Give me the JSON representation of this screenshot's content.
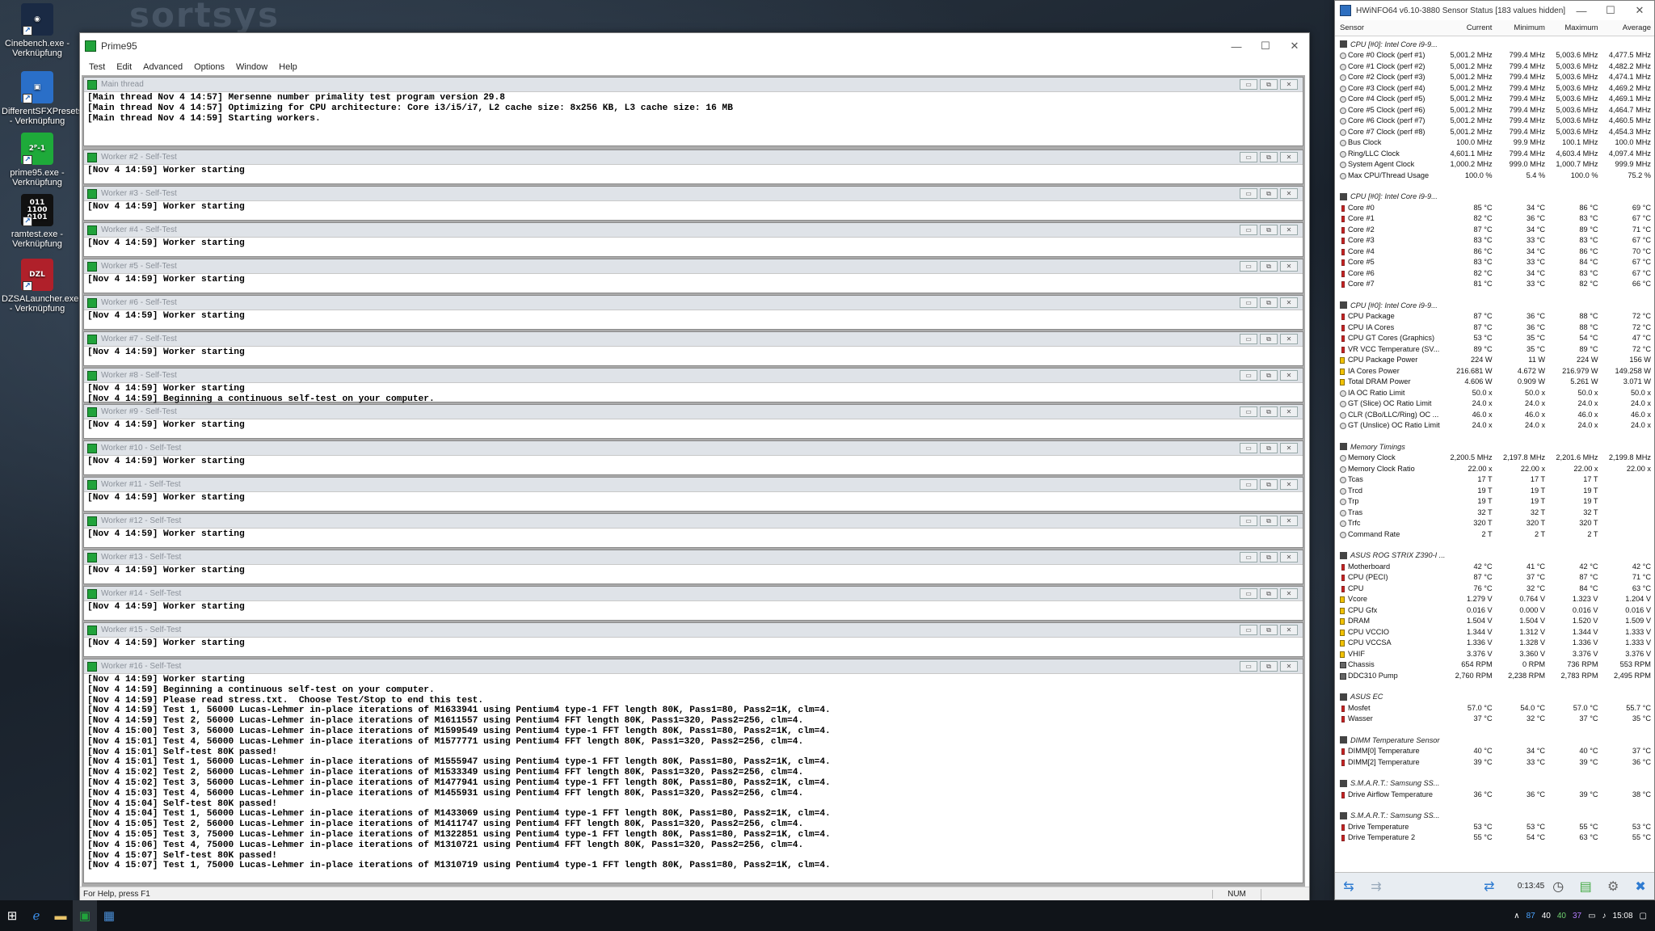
{
  "desktop": {
    "background_text": "sortsys",
    "icons": [
      {
        "label": "Cinebench.exe - Verknüpfung",
        "glyph": "◉",
        "color": "#1a2a44"
      },
      {
        "label": "DifferentSFXPresets... - Verknüpfung",
        "glyph": "▣",
        "color": "#2a6fc8"
      },
      {
        "label": "prime95.exe - Verknüpfung",
        "glyph": "2ᴾ-1",
        "color": "#1eaa3a"
      },
      {
        "label": "ramtest.exe - Verknüpfung",
        "glyph": "011\n1100\n0101",
        "color": "#111111"
      },
      {
        "label": "DZSALauncher.exe - Verknüpfung",
        "glyph": "DZL",
        "color": "#b0202a"
      }
    ]
  },
  "prime95": {
    "title": "Prime95",
    "menu": [
      "Test",
      "Edit",
      "Advanced",
      "Options",
      "Window",
      "Help"
    ],
    "status_text": "For Help, press F1",
    "status_num": "NUM",
    "main_thread": {
      "title": "Main thread",
      "lines": [
        "[Main thread Nov 4 14:57] Mersenne number primality test program version 29.8",
        "[Main thread Nov 4 14:57] Optimizing for CPU architecture: Core i3/i5/i7, L2 cache size: 8x256 KB, L3 cache size: 16 MB",
        "[Main thread Nov 4 14:59] Starting workers."
      ]
    },
    "workers": [
      {
        "title": "Worker #2 - Self-Test",
        "lines": [
          "[Nov 4 14:59] Worker starting"
        ]
      },
      {
        "title": "Worker #3 - Self-Test",
        "lines": [
          "[Nov 4 14:59] Worker starting"
        ]
      },
      {
        "title": "Worker #4 - Self-Test",
        "lines": [
          "[Nov 4 14:59] Worker starting"
        ]
      },
      {
        "title": "Worker #5 - Self-Test",
        "lines": [
          "[Nov 4 14:59] Worker starting"
        ]
      },
      {
        "title": "Worker #6 - Self-Test",
        "lines": [
          "[Nov 4 14:59] Worker starting"
        ]
      },
      {
        "title": "Worker #7 - Self-Test",
        "lines": [
          "[Nov 4 14:59] Worker starting"
        ]
      },
      {
        "title": "Worker #8 - Self-Test",
        "lines": [
          "[Nov 4 14:59] Worker starting",
          "[Nov 4 14:59] Beginning a continuous self-test on your computer."
        ]
      },
      {
        "title": "Worker #9 - Self-Test",
        "lines": [
          "[Nov 4 14:59] Worker starting"
        ]
      },
      {
        "title": "Worker #10 - Self-Test",
        "lines": [
          "[Nov 4 14:59] Worker starting"
        ]
      },
      {
        "title": "Worker #11 - Self-Test",
        "lines": [
          "[Nov 4 14:59] Worker starting"
        ]
      },
      {
        "title": "Worker #12 - Self-Test",
        "lines": [
          "[Nov 4 14:59] Worker starting"
        ]
      },
      {
        "title": "Worker #13 - Self-Test",
        "lines": [
          "[Nov 4 14:59] Worker starting"
        ]
      },
      {
        "title": "Worker #14 - Self-Test",
        "lines": [
          "[Nov 4 14:59] Worker starting"
        ]
      },
      {
        "title": "Worker #15 - Self-Test",
        "lines": [
          "[Nov 4 14:59] Worker starting"
        ]
      }
    ],
    "worker16": {
      "title": "Worker #16 - Self-Test",
      "lines": [
        "[Nov 4 14:59] Worker starting",
        "[Nov 4 14:59] Beginning a continuous self-test on your computer.",
        "[Nov 4 14:59] Please read stress.txt.  Choose Test/Stop to end this test.",
        "[Nov 4 14:59] Test 1, 56000 Lucas-Lehmer in-place iterations of M1633941 using Pentium4 type-1 FFT length 80K, Pass1=80, Pass2=1K, clm=4.",
        "[Nov 4 14:59] Test 2, 56000 Lucas-Lehmer in-place iterations of M1611557 using Pentium4 FFT length 80K, Pass1=320, Pass2=256, clm=4.",
        "[Nov 4 15:00] Test 3, 56000 Lucas-Lehmer in-place iterations of M1599549 using Pentium4 type-1 FFT length 80K, Pass1=80, Pass2=1K, clm=4.",
        "[Nov 4 15:01] Test 4, 56000 Lucas-Lehmer in-place iterations of M1577771 using Pentium4 FFT length 80K, Pass1=320, Pass2=256, clm=4.",
        "[Nov 4 15:01] Self-test 80K passed!",
        "[Nov 4 15:01] Test 1, 56000 Lucas-Lehmer in-place iterations of M1555947 using Pentium4 type-1 FFT length 80K, Pass1=80, Pass2=1K, clm=4.",
        "[Nov 4 15:02] Test 2, 56000 Lucas-Lehmer in-place iterations of M1533349 using Pentium4 FFT length 80K, Pass1=320, Pass2=256, clm=4.",
        "[Nov 4 15:02] Test 3, 56000 Lucas-Lehmer in-place iterations of M1477941 using Pentium4 type-1 FFT length 80K, Pass1=80, Pass2=1K, clm=4.",
        "[Nov 4 15:03] Test 4, 56000 Lucas-Lehmer in-place iterations of M1455931 using Pentium4 FFT length 80K, Pass1=320, Pass2=256, clm=4.",
        "[Nov 4 15:04] Self-test 80K passed!",
        "[Nov 4 15:04] Test 1, 56000 Lucas-Lehmer in-place iterations of M1433069 using Pentium4 type-1 FFT length 80K, Pass1=80, Pass2=1K, clm=4.",
        "[Nov 4 15:05] Test 2, 56000 Lucas-Lehmer in-place iterations of M1411747 using Pentium4 FFT length 80K, Pass1=320, Pass2=256, clm=4.",
        "[Nov 4 15:05] Test 3, 75000 Lucas-Lehmer in-place iterations of M1322851 using Pentium4 type-1 FFT length 80K, Pass1=80, Pass2=1K, clm=4.",
        "[Nov 4 15:06] Test 4, 75000 Lucas-Lehmer in-place iterations of M1310721 using Pentium4 FFT length 80K, Pass1=320, Pass2=256, clm=4.",
        "[Nov 4 15:07] Self-test 80K passed!",
        "[Nov 4 15:07] Test 1, 75000 Lucas-Lehmer in-place iterations of M1310719 using Pentium4 type-1 FFT length 80K, Pass1=80, Pass2=1K, clm=4."
      ]
    }
  },
  "hwinfo": {
    "title": "HWiNFO64 v6.10-3880 Sensor Status [183 values hidden]",
    "columns": [
      "Sensor",
      "Current",
      "Minimum",
      "Maximum",
      "Average"
    ],
    "elapsed": "0:13:45",
    "groups": [
      {
        "name": "CPU [#0]: Intel Core i9-9...",
        "rows": [
          [
            "Core #0 Clock (perf #1)",
            "5,001.2 MHz",
            "799.4 MHz",
            "5,003.6 MHz",
            "4,477.5 MHz",
            "c"
          ],
          [
            "Core #1 Clock (perf #2)",
            "5,001.2 MHz",
            "799.4 MHz",
            "5,003.6 MHz",
            "4,482.2 MHz",
            "c"
          ],
          [
            "Core #2 Clock (perf #3)",
            "5,001.2 MHz",
            "799.4 MHz",
            "5,003.6 MHz",
            "4,474.1 MHz",
            "c"
          ],
          [
            "Core #3 Clock (perf #4)",
            "5,001.2 MHz",
            "799.4 MHz",
            "5,003.6 MHz",
            "4,469.2 MHz",
            "c"
          ],
          [
            "Core #4 Clock (perf #5)",
            "5,001.2 MHz",
            "799.4 MHz",
            "5,003.6 MHz",
            "4,469.1 MHz",
            "c"
          ],
          [
            "Core #5 Clock (perf #6)",
            "5,001.2 MHz",
            "799.4 MHz",
            "5,003.6 MHz",
            "4,464.7 MHz",
            "c"
          ],
          [
            "Core #6 Clock (perf #7)",
            "5,001.2 MHz",
            "799.4 MHz",
            "5,003.6 MHz",
            "4,460.5 MHz",
            "c"
          ],
          [
            "Core #7 Clock (perf #8)",
            "5,001.2 MHz",
            "799.4 MHz",
            "5,003.6 MHz",
            "4,454.3 MHz",
            "c"
          ],
          [
            "Bus Clock",
            "100.0 MHz",
            "99.9 MHz",
            "100.1 MHz",
            "100.0 MHz",
            "c"
          ],
          [
            "Ring/LLC Clock",
            "4,601.1 MHz",
            "799.4 MHz",
            "4,603.4 MHz",
            "4,097.4 MHz",
            "c"
          ],
          [
            "System Agent Clock",
            "1,000.2 MHz",
            "999.0 MHz",
            "1,000.7 MHz",
            "999.9 MHz",
            "c"
          ],
          [
            "Max CPU/Thread Usage",
            "100.0 %",
            "5.4 %",
            "100.0 %",
            "75.2 %",
            "c"
          ]
        ]
      },
      {
        "name": "CPU [#0]: Intel Core i9-9...",
        "rows": [
          [
            "Core #0",
            "85 °C",
            "34 °C",
            "86 °C",
            "69 °C",
            "t"
          ],
          [
            "Core #1",
            "82 °C",
            "36 °C",
            "83 °C",
            "67 °C",
            "t"
          ],
          [
            "Core #2",
            "87 °C",
            "34 °C",
            "89 °C",
            "71 °C",
            "t"
          ],
          [
            "Core #3",
            "83 °C",
            "33 °C",
            "83 °C",
            "67 °C",
            "t"
          ],
          [
            "Core #4",
            "86 °C",
            "34 °C",
            "86 °C",
            "70 °C",
            "t"
          ],
          [
            "Core #5",
            "83 °C",
            "33 °C",
            "84 °C",
            "67 °C",
            "t"
          ],
          [
            "Core #6",
            "82 °C",
            "34 °C",
            "83 °C",
            "67 °C",
            "t"
          ],
          [
            "Core #7",
            "81 °C",
            "33 °C",
            "82 °C",
            "66 °C",
            "t"
          ]
        ]
      },
      {
        "name": "CPU [#0]: Intel Core i9-9...",
        "rows": [
          [
            "CPU Package",
            "87 °C",
            "36 °C",
            "88 °C",
            "72 °C",
            "t"
          ],
          [
            "CPU IA Cores",
            "87 °C",
            "36 °C",
            "88 °C",
            "72 °C",
            "t"
          ],
          [
            "CPU GT Cores (Graphics)",
            "53 °C",
            "35 °C",
            "54 °C",
            "47 °C",
            "t"
          ],
          [
            "VR VCC Temperature (SV...",
            "89 °C",
            "35 °C",
            "89 °C",
            "72 °C",
            "t"
          ],
          [
            "CPU Package Power",
            "224 W",
            "11 W",
            "224 W",
            "156 W",
            "v"
          ],
          [
            "IA Cores Power",
            "216.681 W",
            "4.672 W",
            "216.979 W",
            "149.258 W",
            "v"
          ],
          [
            "Total DRAM Power",
            "4.606 W",
            "0.909 W",
            "5.261 W",
            "3.071 W",
            "v"
          ],
          [
            "IA OC Ratio Limit",
            "50.0 x",
            "50.0 x",
            "50.0 x",
            "50.0 x",
            "c"
          ],
          [
            "GT (Slice) OC Ratio Limit",
            "24.0 x",
            "24.0 x",
            "24.0 x",
            "24.0 x",
            "c"
          ],
          [
            "CLR (CBo/LLC/Ring) OC ...",
            "46.0 x",
            "46.0 x",
            "46.0 x",
            "46.0 x",
            "c"
          ],
          [
            "GT (Unslice) OC Ratio Limit",
            "24.0 x",
            "24.0 x",
            "24.0 x",
            "24.0 x",
            "c"
          ]
        ]
      },
      {
        "name": "Memory Timings",
        "rows": [
          [
            "Memory Clock",
            "2,200.5 MHz",
            "2,197.8 MHz",
            "2,201.6 MHz",
            "2,199.8 MHz",
            "c"
          ],
          [
            "Memory Clock Ratio",
            "22.00 x",
            "22.00 x",
            "22.00 x",
            "22.00 x",
            "c"
          ],
          [
            "Tcas",
            "17 T",
            "17 T",
            "17 T",
            "",
            "c"
          ],
          [
            "Trcd",
            "19 T",
            "19 T",
            "19 T",
            "",
            "c"
          ],
          [
            "Trp",
            "19 T",
            "19 T",
            "19 T",
            "",
            "c"
          ],
          [
            "Tras",
            "32 T",
            "32 T",
            "32 T",
            "",
            "c"
          ],
          [
            "Trfc",
            "320 T",
            "320 T",
            "320 T",
            "",
            "c"
          ],
          [
            "Command Rate",
            "2 T",
            "2 T",
            "2 T",
            "",
            "c"
          ]
        ]
      },
      {
        "name": "ASUS ROG STRIX Z390-I ...",
        "rows": [
          [
            "Motherboard",
            "42 °C",
            "41 °C",
            "42 °C",
            "42 °C",
            "t"
          ],
          [
            "CPU (PECI)",
            "87 °C",
            "37 °C",
            "87 °C",
            "71 °C",
            "t"
          ],
          [
            "CPU",
            "76 °C",
            "32 °C",
            "84 °C",
            "63 °C",
            "t"
          ],
          [
            "Vcore",
            "1.279 V",
            "0.764 V",
            "1.323 V",
            "1.204 V",
            "v"
          ],
          [
            "CPU Gfx",
            "0.016 V",
            "0.000 V",
            "0.016 V",
            "0.016 V",
            "v"
          ],
          [
            "DRAM",
            "1.504 V",
            "1.504 V",
            "1.520 V",
            "1.509 V",
            "v"
          ],
          [
            "CPU VCCIO",
            "1.344 V",
            "1.312 V",
            "1.344 V",
            "1.333 V",
            "v"
          ],
          [
            "CPU VCCSA",
            "1.336 V",
            "1.328 V",
            "1.336 V",
            "1.333 V",
            "v"
          ],
          [
            "VHIF",
            "3.376 V",
            "3.360 V",
            "3.376 V",
            "3.376 V",
            "v"
          ],
          [
            "Chassis",
            "654 RPM",
            "0 RPM",
            "736 RPM",
            "553 RPM",
            "f"
          ],
          [
            "DDC310 Pump",
            "2,760 RPM",
            "2,238 RPM",
            "2,783 RPM",
            "2,495 RPM",
            "f"
          ]
        ]
      },
      {
        "name": "ASUS EC",
        "rows": [
          [
            "Mosfet",
            "57.0 °C",
            "54.0 °C",
            "57.0 °C",
            "55.7 °C",
            "t"
          ],
          [
            "Wasser",
            "37 °C",
            "32 °C",
            "37 °C",
            "35 °C",
            "t"
          ]
        ]
      },
      {
        "name": "DIMM Temperature Sensor",
        "rows": [
          [
            "DIMM[0] Temperature",
            "40 °C",
            "34 °C",
            "40 °C",
            "37 °C",
            "t"
          ],
          [
            "DIMM[2] Temperature",
            "39 °C",
            "33 °C",
            "39 °C",
            "36 °C",
            "t"
          ]
        ]
      },
      {
        "name": "S.M.A.R.T.: Samsung SS...",
        "rows": [
          [
            "Drive Airflow Temperature",
            "36 °C",
            "36 °C",
            "39 °C",
            "38 °C",
            "t"
          ]
        ]
      },
      {
        "name": "S.M.A.R.T.: Samsung SS...",
        "rows": [
          [
            "Drive Temperature",
            "53 °C",
            "53 °C",
            "55 °C",
            "53 °C",
            "t"
          ],
          [
            "Drive Temperature 2",
            "55 °C",
            "54 °C",
            "63 °C",
            "55 °C",
            "t"
          ]
        ]
      }
    ]
  },
  "taskbar": {
    "tray_values": [
      "87",
      "40",
      "40",
      "37"
    ],
    "clock": "15:08"
  }
}
